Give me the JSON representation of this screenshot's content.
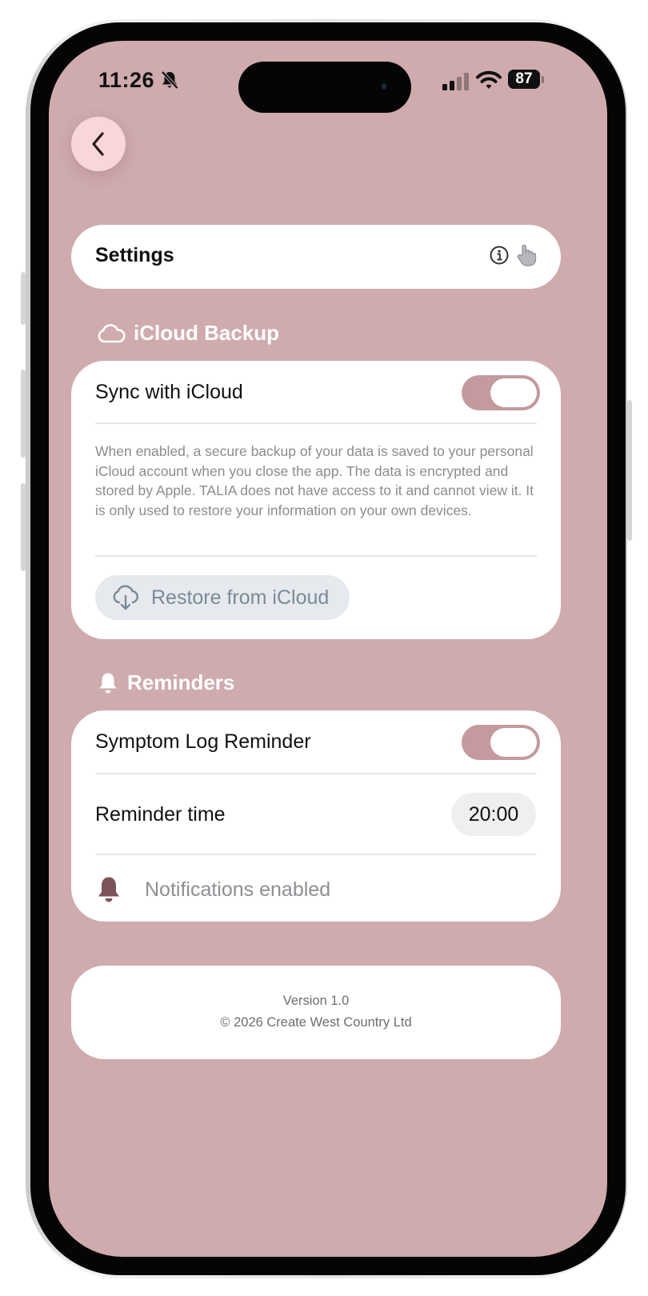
{
  "status_bar": {
    "time": "11:26",
    "battery": "87"
  },
  "header": {
    "title": "Settings"
  },
  "icloud_section": {
    "title": "iCloud Backup",
    "sync_label": "Sync with iCloud",
    "sync_enabled": true,
    "description": "When enabled, a secure backup of your data is saved to your personal iCloud account when you close the app. The data is encrypted and stored by Apple. TALIA does not have access to it and cannot view it. It is only used to restore your information on your own devices.",
    "restore_label": "Restore from iCloud"
  },
  "reminders_section": {
    "title": "Reminders",
    "symptom_label": "Symptom Log Reminder",
    "symptom_enabled": true,
    "time_label": "Reminder time",
    "time_value": "20:00",
    "notifications_label": "Notifications enabled"
  },
  "footer": {
    "version": "Version 1.0",
    "copyright": "© 2026 Create West Country Ltd"
  },
  "colors": {
    "background": "#cfabae",
    "accent": "#c49a9e",
    "back_button": "#f7d7d8",
    "bell_icon": "#7d5259"
  }
}
